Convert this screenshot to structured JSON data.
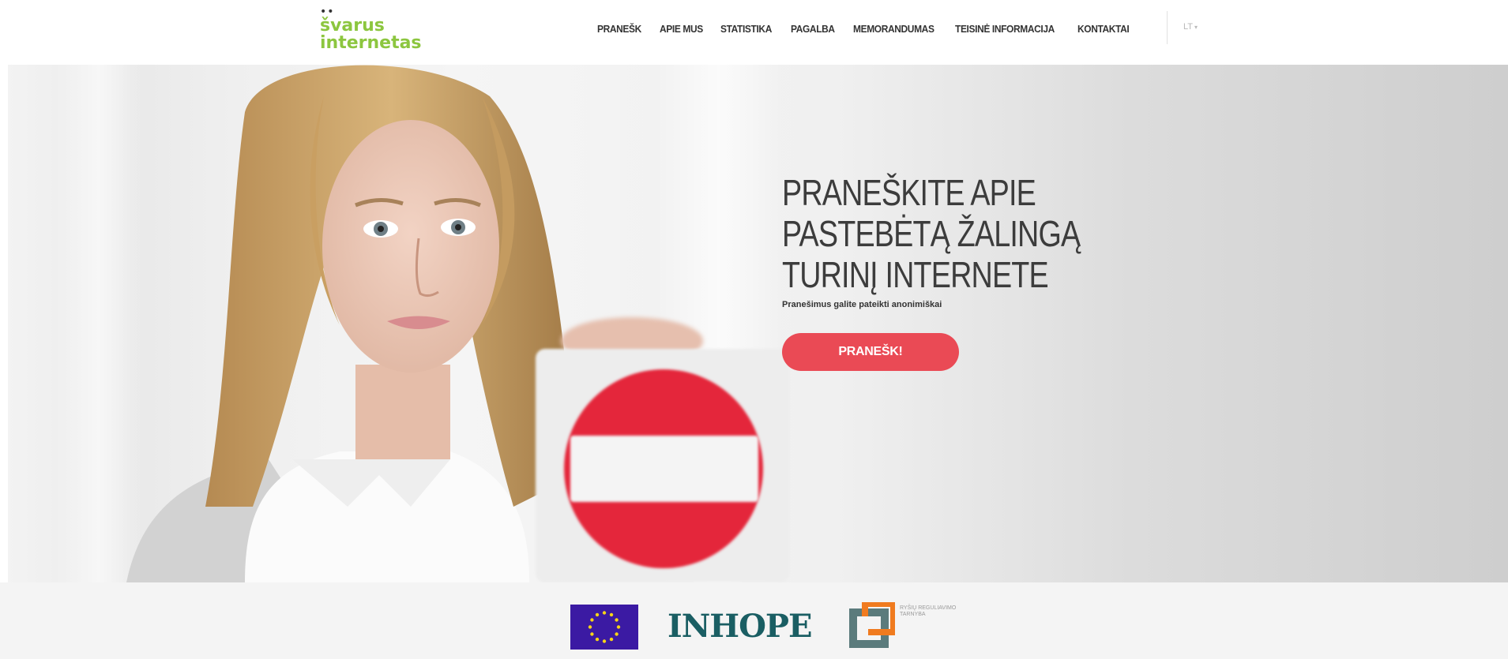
{
  "logo": {
    "line1": "švarus",
    "line2": "internetas",
    "brand_color": "#8cc63f"
  },
  "nav": {
    "items": [
      {
        "label": "PRANEŠK"
      },
      {
        "label": "APIE MUS"
      },
      {
        "label": "STATISTIKA"
      },
      {
        "label": "PAGALBA"
      },
      {
        "label": "MEMORANDUMAS"
      },
      {
        "label": "TEISINĖ INFORMACIJA"
      },
      {
        "label": "KONTAKTAI"
      }
    ],
    "language": "LT"
  },
  "hero": {
    "title_lines": [
      "PRANEŠKITE APIE",
      "PASTEBĖTĄ ŽALINGĄ",
      "TURINĮ INTERNETE"
    ],
    "subtitle": "Pranešimus galite pateikti anonimiškai",
    "cta_label": "PRANEŠK!",
    "cta_color": "#ea4a55"
  },
  "partners": {
    "inhope": "INHOPE",
    "rrt_text": "RYŠIŲ REGULIAVIMO TARNYBA"
  }
}
